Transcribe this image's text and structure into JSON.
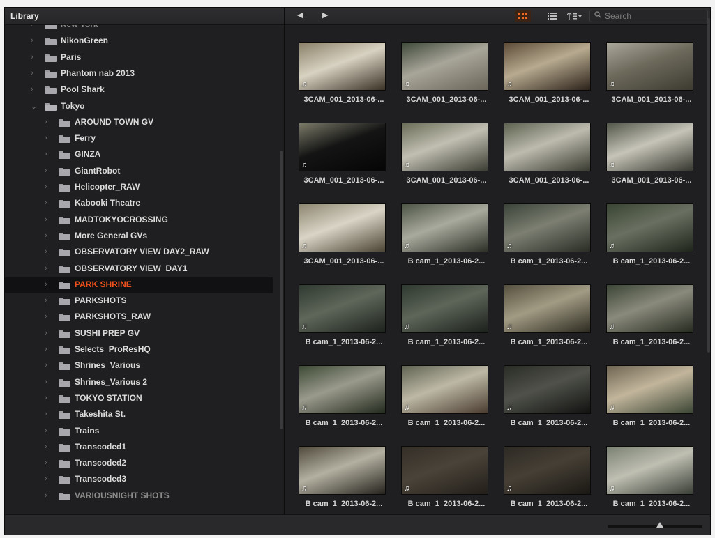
{
  "library": {
    "title": "Library",
    "items": [
      {
        "label": "New York",
        "level": 0,
        "state": "dim"
      },
      {
        "label": "NikonGreen",
        "level": 0
      },
      {
        "label": "Paris",
        "level": 0
      },
      {
        "label": "Phantom nab 2013",
        "level": 0
      },
      {
        "label": "Pool Shark",
        "level": 0
      },
      {
        "label": "Tokyo",
        "level": 0,
        "expanded": true
      },
      {
        "label": "AROUND TOWN GV",
        "level": 1
      },
      {
        "label": "Ferry",
        "level": 1
      },
      {
        "label": "GINZA",
        "level": 1
      },
      {
        "label": "GiantRobot",
        "level": 1
      },
      {
        "label": "Helicopter_RAW",
        "level": 1
      },
      {
        "label": "Kabooki Theatre",
        "level": 1
      },
      {
        "label": "MADTOKYOCROSSING",
        "level": 1
      },
      {
        "label": "More General GVs",
        "level": 1
      },
      {
        "label": "OBSERVATORY VIEW DAY2_RAW",
        "level": 1
      },
      {
        "label": "OBSERVATORY VIEW_DAY1",
        "level": 1
      },
      {
        "label": "PARK SHRINE",
        "level": 1,
        "selected": true
      },
      {
        "label": "PARKSHOTS",
        "level": 1
      },
      {
        "label": "PARKSHOTS_RAW",
        "level": 1
      },
      {
        "label": "SUSHI PREP GV",
        "level": 1
      },
      {
        "label": "Selects_ProResHQ",
        "level": 1
      },
      {
        "label": "Shrines_Various",
        "level": 1
      },
      {
        "label": "Shrines_Various 2",
        "level": 1
      },
      {
        "label": "TOKYO STATION",
        "level": 1
      },
      {
        "label": "Takeshita St.",
        "level": 1
      },
      {
        "label": "Trains",
        "level": 1
      },
      {
        "label": "Transcoded1",
        "level": 1
      },
      {
        "label": "Transcoded2",
        "level": 1
      },
      {
        "label": "Transcoded3",
        "level": 1
      },
      {
        "label": "VARIOUSNIGHT SHOTS",
        "level": 1,
        "state": "dim"
      }
    ]
  },
  "toolbar": {
    "back_icon": "◀",
    "forward_icon": "▶",
    "thumbnail_view_icon": "grid-icon",
    "list_view_icon": "list-icon",
    "sort_icon": "sort-icon",
    "search_placeholder": "Search"
  },
  "colors": {
    "accent": "#f0511c",
    "background": "#1f1f21",
    "selected_row": "#111114"
  },
  "clips": [
    {
      "label": "3CAM_001_2013-06-...",
      "audio": true,
      "tones": [
        "#8a8068",
        "#d8d2c2",
        "#3b3226"
      ]
    },
    {
      "label": "3CAM_001_2013-06-...",
      "audio": true,
      "tones": [
        "#3f4a3a",
        "#a8a599",
        "#6b6559"
      ]
    },
    {
      "label": "3CAM_001_2013-06-...",
      "audio": true,
      "tones": [
        "#5c4a36",
        "#b7aa90",
        "#2c2219"
      ]
    },
    {
      "label": "3CAM_001_2013-06-...",
      "audio": true,
      "tones": [
        "#aaa79b",
        "#6d6a5c",
        "#3d3a31"
      ]
    },
    {
      "label": "3CAM_001_2013-06-...",
      "audio": true,
      "tones": [
        "#7b7a68",
        "#141414",
        "#050505"
      ]
    },
    {
      "label": "3CAM_001_2013-06-...",
      "audio": true,
      "tones": [
        "#6a6d58",
        "#c1bfb2",
        "#3c3d33"
      ]
    },
    {
      "label": "3CAM_001_2013-06-...",
      "audio": false,
      "tones": [
        "#5d6250",
        "#bdbbae",
        "#3a3b31"
      ]
    },
    {
      "label": "3CAM_001_2013-06-...",
      "audio": true,
      "tones": [
        "#525749",
        "#c6c4b8",
        "#36372f"
      ]
    },
    {
      "label": "3CAM_001_2013-06-...",
      "audio": true,
      "tones": [
        "#8d8671",
        "#d9d4c6",
        "#4c4535"
      ]
    },
    {
      "label": "B cam_1_2013-06-2...",
      "audio": true,
      "tones": [
        "#4d5545",
        "#a9aa9e",
        "#2c3026"
      ]
    },
    {
      "label": "B cam_1_2013-06-2...",
      "audio": true,
      "tones": [
        "#3b4338",
        "#7c7f72",
        "#2a2d25"
      ]
    },
    {
      "label": "B cam_1_2013-06-2...",
      "audio": true,
      "tones": [
        "#3a4533",
        "#6a7061",
        "#1f251b"
      ]
    },
    {
      "label": "B cam_1_2013-06-2...",
      "audio": true,
      "tones": [
        "#2f3a30",
        "#5f665a",
        "#1c221c"
      ]
    },
    {
      "label": "B cam_1_2013-06-2...",
      "audio": true,
      "tones": [
        "#2e392f",
        "#5e6559",
        "#1b211b"
      ]
    },
    {
      "label": "B cam_1_2013-06-2...",
      "audio": true,
      "tones": [
        "#55503e",
        "#a29b84",
        "#2c2a20"
      ]
    },
    {
      "label": "B cam_1_2013-06-2...",
      "audio": true,
      "tones": [
        "#3c4636",
        "#8a8a7c",
        "#262b20"
      ]
    },
    {
      "label": "B cam_1_2013-06-2...",
      "audio": true,
      "tones": [
        "#3d4a35",
        "#9a9a8c",
        "#232a1e"
      ]
    },
    {
      "label": "B cam_1_2013-06-2...",
      "audio": true,
      "tones": [
        "#606352",
        "#bdb8a5",
        "#4a3c30"
      ]
    },
    {
      "label": "B cam_1_2013-06-2...",
      "audio": true,
      "tones": [
        "#2a2c26",
        "#4f514a",
        "#121311"
      ]
    },
    {
      "label": "B cam_1_2013-06-2...",
      "audio": true,
      "tones": [
        "#6e6551",
        "#c2b59c",
        "#3b4634"
      ]
    },
    {
      "label": "B cam_1_2013-06-2...",
      "audio": true,
      "tones": [
        "#4f4a3c",
        "#b4b0a1",
        "#25231d"
      ]
    },
    {
      "label": "B cam_1_2013-06-2...",
      "audio": true,
      "tones": [
        "#332e27",
        "#4a4339",
        "#221e19"
      ]
    },
    {
      "label": "B cam_1_2013-06-2...",
      "audio": true,
      "tones": [
        "#2d2a24",
        "#463f35",
        "#1a1814"
      ]
    },
    {
      "label": "B cam_1_2013-06-2...",
      "audio": true,
      "tones": [
        "#7a8172",
        "#bfbfb2",
        "#3a3f37"
      ]
    }
  ],
  "footer": {
    "zoom_level": 0.55
  }
}
